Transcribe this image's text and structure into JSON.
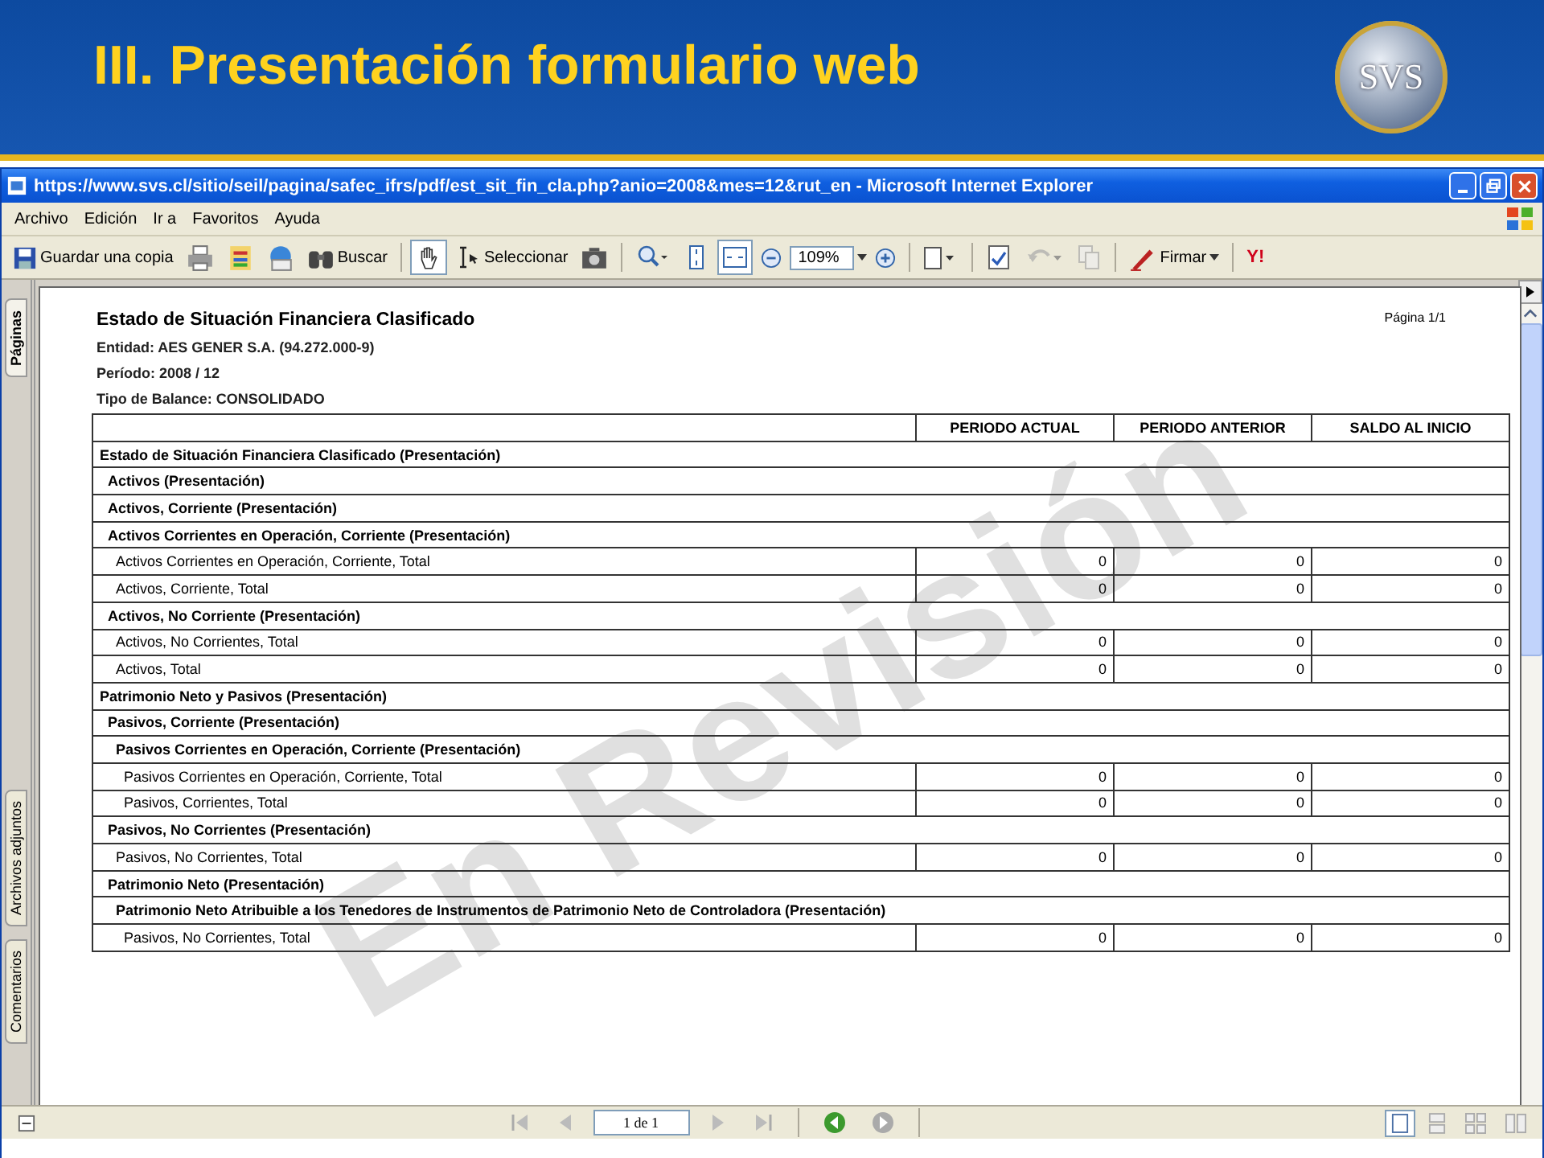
{
  "slide": {
    "title": "III. Presentación formulario web",
    "logo_text": "SVS"
  },
  "window": {
    "title": "https://www.svs.cl/sitio/seil/pagina/safec_ifrs/pdf/est_sit_fin_cla.php?anio=2008&mes=12&rut_en - Microsoft Internet Explorer"
  },
  "menu": [
    "Archivo",
    "Edición",
    "Ir a",
    "Favoritos",
    "Ayuda"
  ],
  "toolbar": {
    "save_label": "Guardar una copia",
    "search_label": "Buscar",
    "tools": [
      {
        "kind": "hand",
        "selected": true
      },
      {
        "kind": "select",
        "label": "Seleccionar",
        "selected": false
      }
    ],
    "fit": [
      {
        "kind": "page",
        "selected": false
      },
      {
        "kind": "width",
        "selected": true
      }
    ],
    "zoom": "109%",
    "sign_label": "Firmar",
    "yahoo_label": "Y!"
  },
  "side_tabs": [
    {
      "label": "Páginas",
      "selected": true
    },
    {
      "label": "Archivos adjuntos",
      "selected": false
    },
    {
      "label": "Comentarios",
      "selected": false
    }
  ],
  "document": {
    "title": "Estado de Situación Financiera Clasificado",
    "page_label": "Página 1/1",
    "info": [
      "Entidad: AES GENER S.A. (94.272.000-9)",
      "Período: 2008 / 12",
      "Tipo de Balance: CONSOLIDADO"
    ],
    "watermark": "En Revisión",
    "table": {
      "columns": [
        "PERIODO ACTUAL",
        "PERIODO ANTERIOR",
        "SALDO AL INICIO"
      ],
      "rows": [
        {
          "kind": "section",
          "label": "Estado de Situación Financiera Clasificado (Presentación)",
          "children": [
            {
              "kind": "section",
              "label": "Activos (Presentación)"
            },
            {
              "kind": "section",
              "label": "Activos, Corriente (Presentación)"
            },
            {
              "kind": "section",
              "label": "Activos Corrientes en Operación, Corriente (Presentación)",
              "children": [
                {
                  "kind": "total",
                  "label": "Activos Corrientes en Operación, Corriente, Total",
                  "values": [
                    "0",
                    "0",
                    "0"
                  ]
                },
                {
                  "kind": "total",
                  "label": "Activos, Corriente, Total",
                  "values": [
                    "0",
                    "0",
                    "0"
                  ]
                }
              ]
            },
            {
              "kind": "section",
              "label": "Activos, No Corriente (Presentación)",
              "children": [
                {
                  "kind": "total",
                  "label": "Activos, No Corrientes, Total",
                  "values": [
                    "0",
                    "0",
                    "0"
                  ]
                },
                {
                  "kind": "total",
                  "label": "Activos, Total",
                  "values": [
                    "0",
                    "0",
                    "0"
                  ]
                }
              ]
            }
          ]
        },
        {
          "kind": "section",
          "label": "Patrimonio Neto y Pasivos (Presentación)",
          "children": [
            {
              "kind": "section",
              "label": "Pasivos, Corriente (Presentación)",
              "children": [
                {
                  "kind": "section",
                  "label": "Pasivos Corrientes en Operación, Corriente (Presentación)",
                  "children": [
                    {
                      "kind": "total",
                      "label": "Pasivos Corrientes en Operación, Corriente, Total",
                      "values": [
                        "0",
                        "0",
                        "0"
                      ]
                    },
                    {
                      "kind": "total",
                      "label": "Pasivos, Corrientes, Total",
                      "values": [
                        "0",
                        "0",
                        "0"
                      ]
                    }
                  ]
                }
              ]
            },
            {
              "kind": "section",
              "label": "Pasivos, No Corrientes (Presentación)",
              "children": [
                {
                  "kind": "total",
                  "label": "Pasivos, No Corrientes, Total",
                  "values": [
                    "0",
                    "0",
                    "0"
                  ]
                }
              ]
            },
            {
              "kind": "section",
              "label": "Patrimonio Neto (Presentación)",
              "children": [
                {
                  "kind": "section",
                  "label": "Patrimonio Neto Atribuible a los Tenedores de Instrumentos de Patrimonio Neto de Controladora (Presentación)",
                  "children": [
                    {
                      "kind": "total",
                      "label": "Pasivos, No Corrientes, Total",
                      "values": [
                        "0",
                        "0",
                        "0"
                      ]
                    }
                  ]
                }
              ]
            }
          ]
        }
      ]
    }
  },
  "pager": {
    "page_field": "1 de 1"
  }
}
